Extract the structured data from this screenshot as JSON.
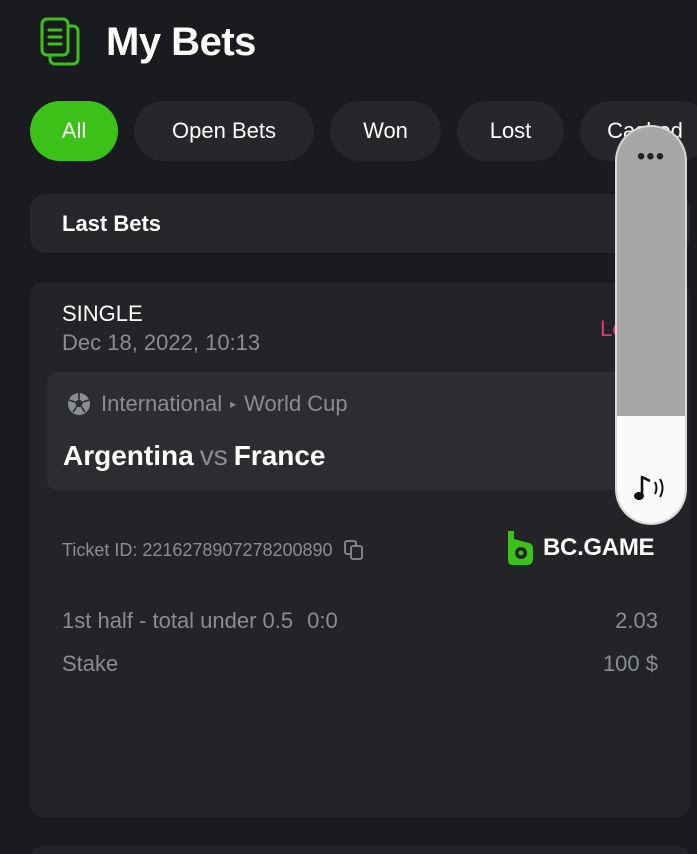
{
  "header": {
    "title": "My Bets",
    "icon": "bets-document-icon"
  },
  "tabs": [
    {
      "label": "All",
      "active": true
    },
    {
      "label": "Open Bets",
      "active": false
    },
    {
      "label": "Won",
      "active": false
    },
    {
      "label": "Lost",
      "active": false
    },
    {
      "label": "Cashed",
      "active": false
    }
  ],
  "filter": {
    "selected": "Last Bets"
  },
  "bet": {
    "type": "SINGLE",
    "date": "Dec 18, 2022, 10:13",
    "status": "Lost",
    "event": {
      "sport_icon": "soccer-ball-icon",
      "category": "International",
      "tournament": "World Cup",
      "home_team": "Argentina",
      "vs": "vs",
      "away_team": "France"
    },
    "ticket_label": "Ticket ID: 2216278907278200890",
    "brand": "BC.GAME",
    "market": "1st half - total under 0.5",
    "score": "0:0",
    "odds": "2.03",
    "stake_label": "Stake",
    "stake_value": "100 $"
  },
  "volume_overlay": {
    "menu": "•••",
    "level": 0.27,
    "icon": "music-volume-icon"
  },
  "colors": {
    "accent": "#3bc117",
    "lost": "#e8337a",
    "background": "#1a1b1e",
    "card": "#232428"
  }
}
